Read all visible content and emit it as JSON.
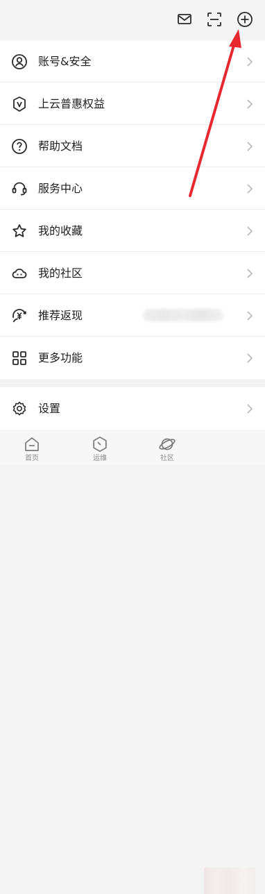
{
  "topbar": {
    "icons": [
      "mail-icon",
      "scan-icon",
      "add-circle-icon"
    ]
  },
  "menu": {
    "items": [
      {
        "label": "账号&安全",
        "icon": "account-security-icon"
      },
      {
        "label": "上云普惠权益",
        "icon": "shield-v-icon"
      },
      {
        "label": "帮助文档",
        "icon": "help-icon"
      },
      {
        "label": "服务中心",
        "icon": "headset-icon"
      },
      {
        "label": "我的收藏",
        "icon": "star-icon"
      },
      {
        "label": "我的社区",
        "icon": "community-icon"
      },
      {
        "label": "推荐返现",
        "icon": "cashback-icon"
      },
      {
        "label": "更多功能",
        "icon": "grid-icon"
      }
    ],
    "settings": {
      "label": "设置",
      "icon": "gear-icon"
    }
  },
  "tabbar": {
    "items": [
      {
        "label": "首页",
        "icon": "home-icon"
      },
      {
        "label": "运维",
        "icon": "ops-icon"
      },
      {
        "label": "社区",
        "icon": "planet-icon"
      }
    ]
  },
  "annotation": {
    "arrow_color": "#e8282f"
  }
}
